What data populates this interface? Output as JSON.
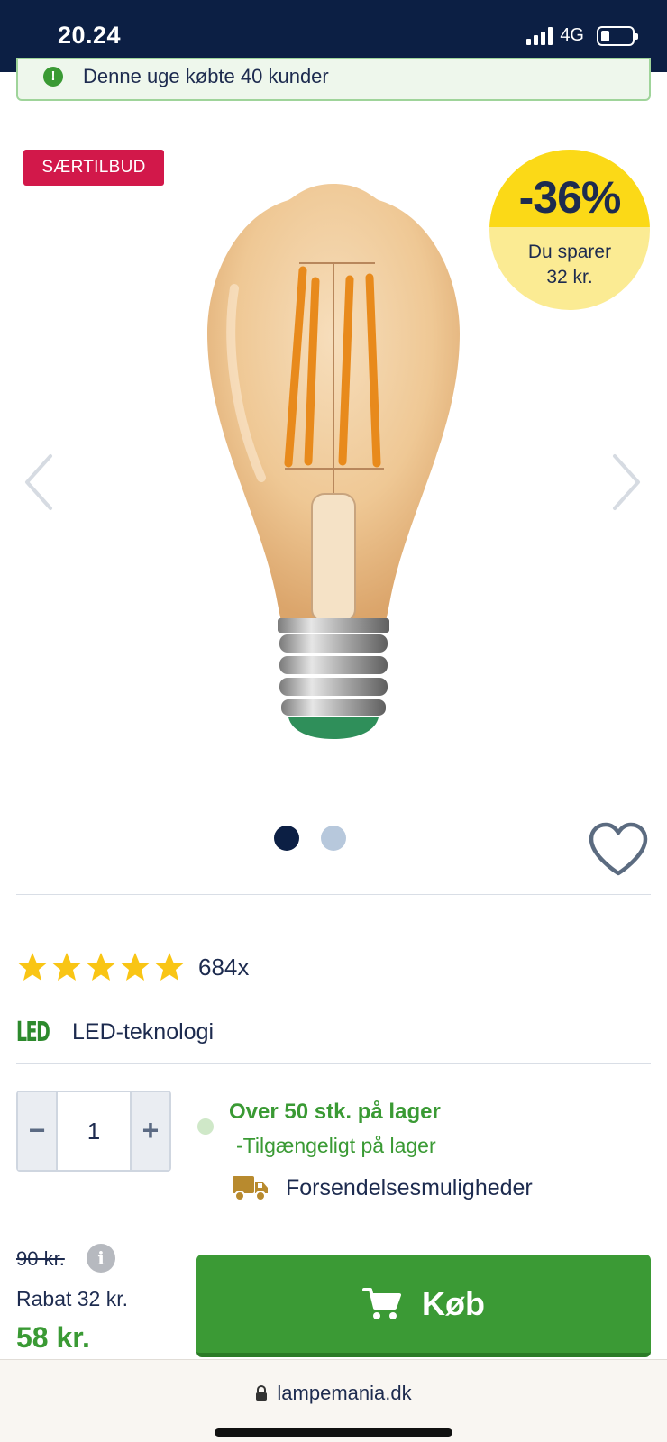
{
  "status_bar": {
    "time": "20.24",
    "network": "4G"
  },
  "notice": {
    "text": "Denne uge købte 40 kunder"
  },
  "product": {
    "special_badge": "SÆRTILBUD",
    "discount_percent": "-36%",
    "discount_save_line1": "Du sparer",
    "discount_save_line2": "32 kr.",
    "gallery_total_images": 2,
    "gallery_active_index": 0,
    "rating_stars": 5,
    "rating_count": "684x",
    "feature_logo": "LED",
    "feature_label": "LED-teknologi"
  },
  "purchase": {
    "quantity": "1",
    "minus": "−",
    "plus": "+",
    "stock_title": "Over 50 stk. på lager",
    "stock_subtitle": "-Tilgængeligt på lager",
    "shipping_label": "Forsendelsesmuligheder",
    "old_price": "90 kr.",
    "info": "i",
    "discount_line": "Rabat 32 kr.",
    "new_price": "58 kr.",
    "buy_label": "Køb"
  },
  "browser": {
    "url": "lampemania.dk"
  },
  "colors": {
    "header_navy": "#0c1f44",
    "accent_green": "#3a9a34",
    "badge_red": "#d2184a",
    "discount_yellow": "#fbd917",
    "star_yellow": "#f9c515"
  }
}
